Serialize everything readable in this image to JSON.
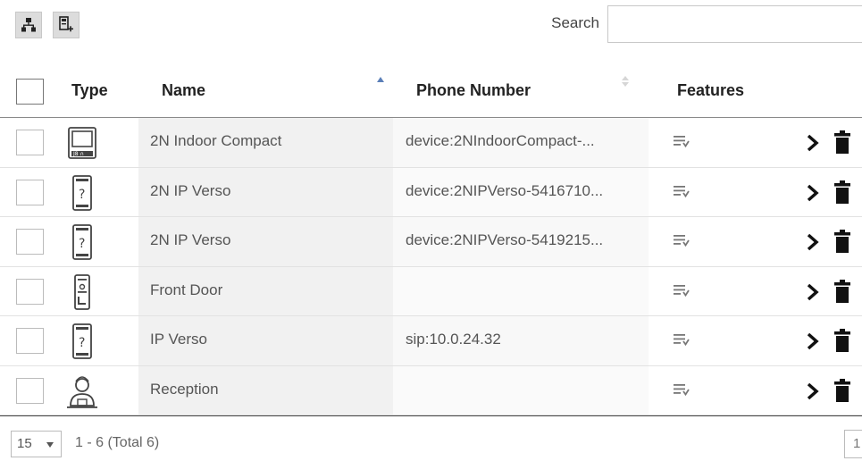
{
  "toolbar": {
    "tree_button_icon": "tree-hierarchy-icon",
    "add_button_icon": "add-device-icon"
  },
  "search": {
    "label": "Search",
    "value": ""
  },
  "table": {
    "columns": {
      "type": "Type",
      "name": "Name",
      "phone": "Phone Number",
      "features": "Features"
    },
    "sort": {
      "column": "name",
      "direction": "ascending"
    },
    "rows": [
      {
        "type_icon": "indoor-compact-icon",
        "name": "2N Indoor Compact",
        "phone": "device:2NIndoorCompact-..."
      },
      {
        "type_icon": "ip-verso-icon",
        "name": "2N IP Verso",
        "phone": "device:2NIPVerso-5416710..."
      },
      {
        "type_icon": "ip-verso-icon",
        "name": "2N IP Verso",
        "phone": "device:2NIPVerso-5419215..."
      },
      {
        "type_icon": "door-station-icon",
        "name": "Front Door",
        "phone": ""
      },
      {
        "type_icon": "ip-verso-icon",
        "name": "IP Verso",
        "phone": "sip:10.0.24.32"
      },
      {
        "type_icon": "receptionist-icon",
        "name": "Reception",
        "phone": ""
      }
    ]
  },
  "footer": {
    "page_size": "15",
    "range_text": "1 - 6 (Total 6)",
    "current_page": "1"
  }
}
